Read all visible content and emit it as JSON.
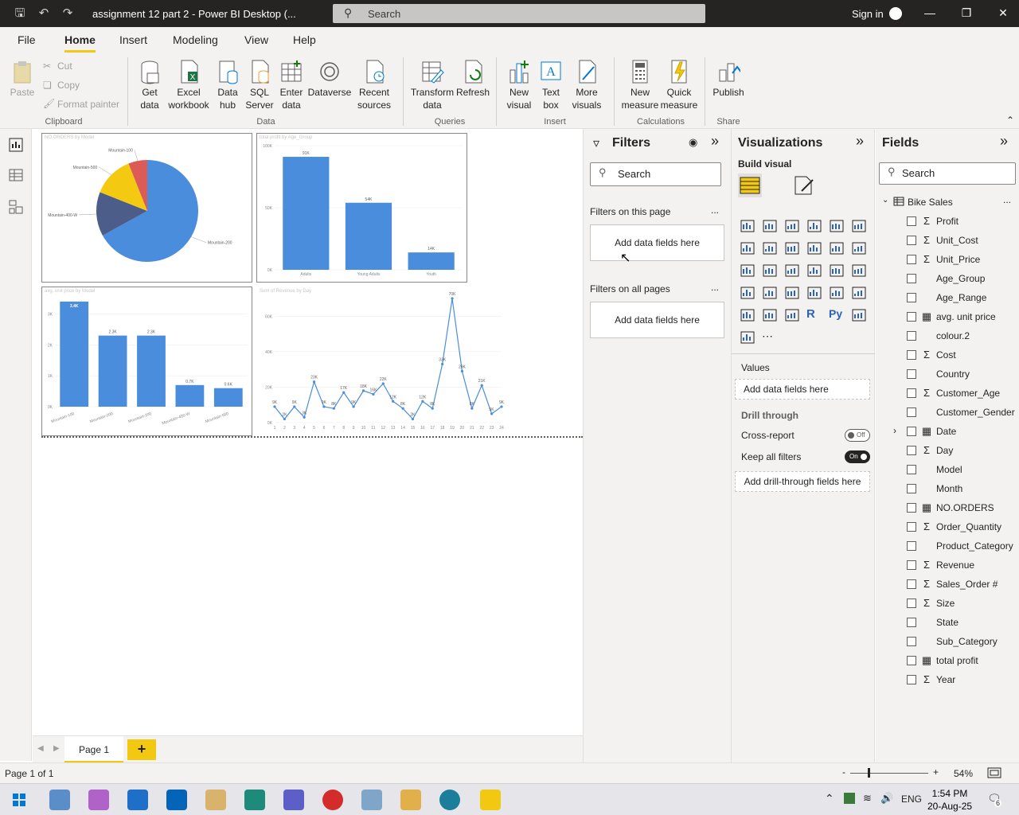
{
  "title_bar": {
    "title": "assignment 12 part 2 - Power BI Desktop (...",
    "search_placeholder": "Search",
    "sign_in": "Sign in"
  },
  "menu": {
    "tabs": [
      "File",
      "Home",
      "Insert",
      "Modeling",
      "View",
      "Help"
    ],
    "active": "Home"
  },
  "ribbon": {
    "clipboard": {
      "paste": "Paste",
      "cut": "Cut",
      "copy": "Copy",
      "format_painter": "Format painter",
      "group": "Clipboard"
    },
    "data": {
      "get_data": "Get data",
      "excel": "Excel workbook",
      "data_hub": "Data hub",
      "sql": "SQL Server",
      "enter_data": "Enter data",
      "dataverse": "Dataverse",
      "recent": "Recent sources",
      "group": "Data"
    },
    "queries": {
      "transform": "Transform data",
      "refresh": "Refresh",
      "group": "Queries"
    },
    "insert": {
      "new_visual": "New visual",
      "text_box": "Text box",
      "more_visuals": "More visuals",
      "group": "Insert"
    },
    "calculations": {
      "new_measure": "New measure",
      "quick_measure": "Quick measure",
      "group": "Calculations"
    },
    "share": {
      "publish": "Publish",
      "group": "Share"
    }
  },
  "canvas": {
    "charts": [
      {
        "id": "pie",
        "title": "NO.ORDERS by Model"
      },
      {
        "id": "bar1",
        "title": "total profit by Age_Group"
      },
      {
        "id": "bar2",
        "title": "avg. unit price by Model"
      },
      {
        "id": "line",
        "title": "Sum of Revenue by Day"
      }
    ]
  },
  "chart_data": [
    {
      "type": "pie",
      "title": "NO.ORDERS by Model",
      "slices": [
        {
          "label": "Mountain-200",
          "value": 0.67,
          "color": "#4a8ddc"
        },
        {
          "label": "Mountain-400-W",
          "value": 0.14,
          "color": "#4c5d8a"
        },
        {
          "label": "Mountain-500",
          "value": 0.13,
          "color": "#f3c911"
        },
        {
          "label": "Mountain-100",
          "value": 0.06,
          "color": "#dc5b57"
        }
      ]
    },
    {
      "type": "bar",
      "title": "total profit by Age_Group",
      "categories": [
        "Adults",
        "Young Adults",
        "Youth"
      ],
      "values": [
        91000,
        54000,
        14000
      ],
      "data_labels": [
        "91K",
        "54K",
        "14K"
      ],
      "yticks": [
        "0K",
        "50K",
        "100K"
      ],
      "ylim": [
        0,
        100000
      ],
      "color": "#4a8ddc"
    },
    {
      "type": "bar",
      "title": "avg. unit price by Model",
      "categories": [
        "Mountain-100",
        "Mountain-200",
        "Mountain-400-W",
        "Mountain-500"
      ],
      "bars": [
        3400,
        2300,
        2300,
        700,
        600
      ],
      "bar_categories": [
        "Mountain-100",
        "Mountain-200",
        "Mountain-200",
        "Mountain-400-W",
        "Mountain-500"
      ],
      "data_labels": [
        "3.4K",
        "2.3K",
        "2.3K",
        "0.7K",
        "0.6K"
      ],
      "yticks": [
        "0K",
        "1K",
        "2K",
        "3K"
      ],
      "ylim": [
        0,
        3500
      ],
      "color": "#4a8ddc"
    },
    {
      "type": "line",
      "title": "Sum of Revenue by Day",
      "x": [
        1,
        2,
        3,
        4,
        5,
        6,
        7,
        8,
        9,
        10,
        11,
        12,
        13,
        14,
        15,
        16,
        17,
        18,
        19,
        20,
        21,
        22,
        23,
        24
      ],
      "values": [
        9000,
        2000,
        9000,
        3000,
        23000,
        9000,
        8000,
        17000,
        9000,
        18000,
        16000,
        22000,
        12000,
        8000,
        2000,
        12000,
        8000,
        33000,
        70000,
        29000,
        8000,
        21000,
        5000,
        9000
      ],
      "data_labels": [
        "9K",
        "2K",
        "9K",
        "3K",
        "23K",
        "9K",
        "8K",
        "17K",
        "9K",
        "18K",
        "16K",
        "22K",
        "12K",
        "8K",
        "2K",
        "12K",
        "8K",
        "33K",
        "70K",
        "29K",
        "8K",
        "21K",
        "5K",
        "9K"
      ],
      "yticks": [
        "0K",
        "20K",
        "40K",
        "60K"
      ],
      "ylim": [
        0,
        70000
      ],
      "color": "#4a8ddc"
    }
  ],
  "pages": {
    "tab": "Page 1",
    "add": "+"
  },
  "filters": {
    "title": "Filters",
    "search": "Search",
    "on_page": "Filters on this page",
    "on_all": "Filters on all pages",
    "add_fields": "Add data fields here",
    "more": "..."
  },
  "visualizations": {
    "title": "Visualizations",
    "build": "Build visual",
    "values": "Values",
    "add_fields": "Add data fields here",
    "drill": "Drill through",
    "cross_report": "Cross-report",
    "cross_state": "Off",
    "keep_filters": "Keep all filters",
    "keep_state": "On",
    "add_drill": "Add drill-through fields here",
    "more": "..."
  },
  "fields": {
    "title": "Fields",
    "search": "Search",
    "table": "Bike Sales",
    "items": [
      {
        "name": "Profit",
        "type": "sigma"
      },
      {
        "name": "Unit_Cost",
        "type": "sigma"
      },
      {
        "name": "Unit_Price",
        "type": "sigma"
      },
      {
        "name": "Age_Group",
        "type": ""
      },
      {
        "name": "Age_Range",
        "type": ""
      },
      {
        "name": "avg. unit price",
        "type": "measure"
      },
      {
        "name": "colour.2",
        "type": ""
      },
      {
        "name": "Cost",
        "type": "sigma"
      },
      {
        "name": "Country",
        "type": ""
      },
      {
        "name": "Customer_Age",
        "type": "sigma"
      },
      {
        "name": "Customer_Gender",
        "type": ""
      },
      {
        "name": "Date",
        "type": "date"
      },
      {
        "name": "Day",
        "type": "sigma"
      },
      {
        "name": "Model",
        "type": ""
      },
      {
        "name": "Month",
        "type": ""
      },
      {
        "name": "NO.ORDERS",
        "type": "measure"
      },
      {
        "name": "Order_Quantity",
        "type": "sigma"
      },
      {
        "name": "Product_Category",
        "type": ""
      },
      {
        "name": "Revenue",
        "type": "sigma"
      },
      {
        "name": "Sales_Order #",
        "type": "sigma"
      },
      {
        "name": "Size",
        "type": "sigma"
      },
      {
        "name": "State",
        "type": ""
      },
      {
        "name": "Sub_Category",
        "type": ""
      },
      {
        "name": "total profit",
        "type": "measure"
      },
      {
        "name": "Year",
        "type": "sigma"
      }
    ]
  },
  "status": {
    "page": "Page 1 of 1",
    "zoom": "54%"
  },
  "taskbar": {
    "lang": "ENG",
    "time": "1:54 PM",
    "date": "20-Aug-25",
    "notif": "6"
  },
  "colors": {
    "accent": "#f2c811",
    "bar": "#4a8ddc"
  }
}
